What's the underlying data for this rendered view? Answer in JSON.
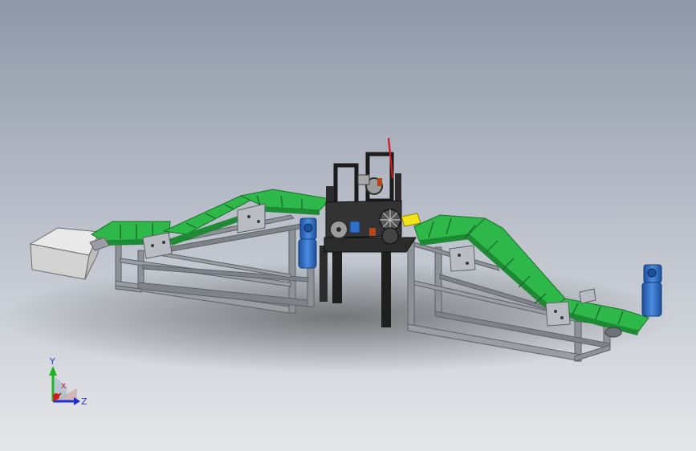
{
  "viewport": {
    "background_top": "#8f98a8",
    "background_bottom": "#e6e7ea"
  },
  "model": {
    "belt_color": "#2fb84a",
    "frame_color": "#8e9197",
    "motor_color": "#2f6fc6",
    "accent_yellow": "#f2e21a",
    "accent_red": "#d11a1a",
    "hopper_color": "#d3d3d3"
  },
  "triad": {
    "y_label": "Y",
    "x_label": "X",
    "z_label": "Z",
    "y_color": "#1fb31f",
    "x_color": "#d11a1a",
    "z_color": "#1f2fcf"
  }
}
